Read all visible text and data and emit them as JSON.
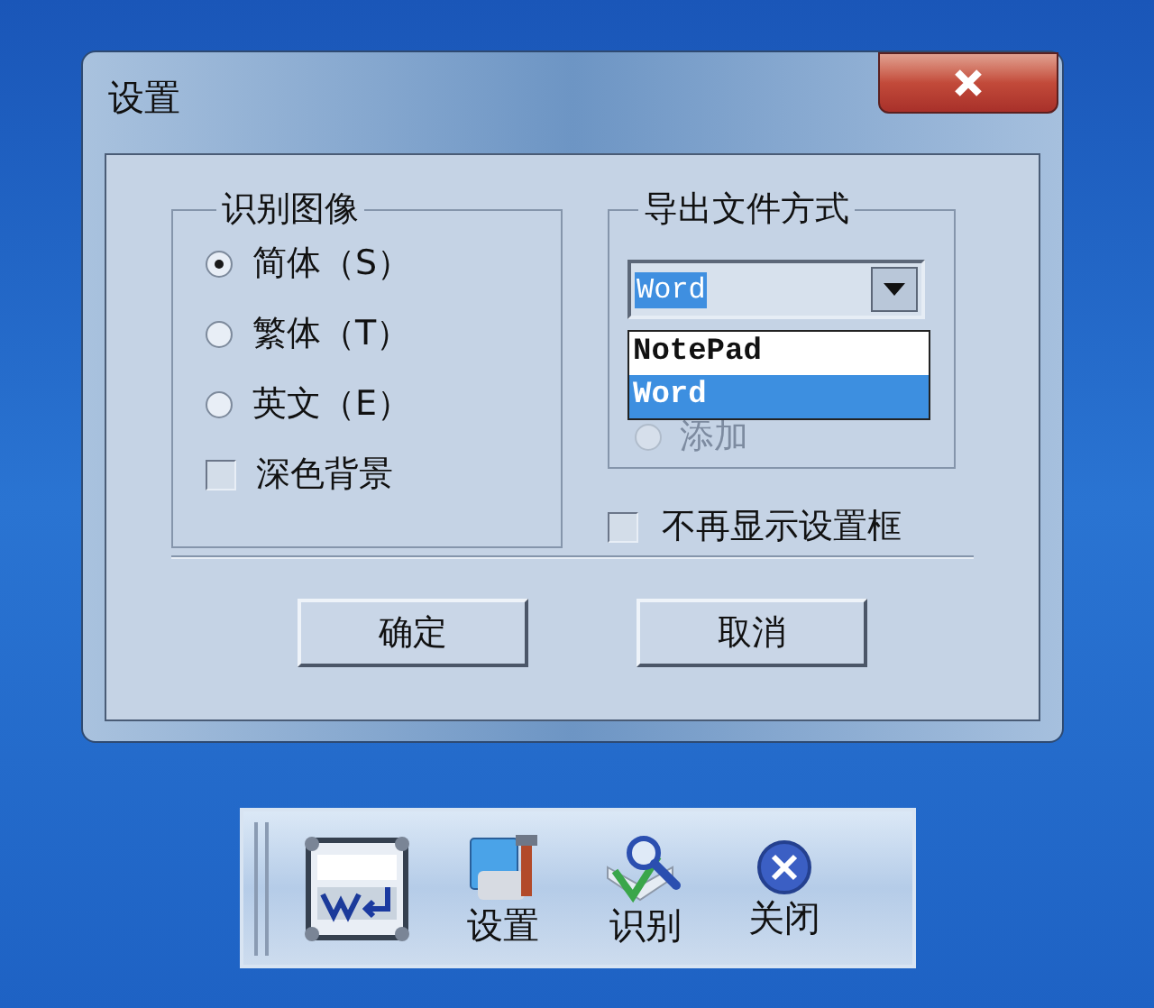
{
  "window": {
    "title": "设置"
  },
  "recognize_group": {
    "title": "识别图像",
    "options": [
      {
        "label": "简体（S）",
        "selected": true
      },
      {
        "label": "繁体（T）",
        "selected": false
      },
      {
        "label": "英文（E）",
        "selected": false
      }
    ],
    "dark_background": {
      "label": "深色背景",
      "checked": false
    }
  },
  "export_group": {
    "title": "导出文件方式",
    "combo": {
      "value": "Word",
      "expanded": true
    },
    "list": [
      {
        "label": "NotePad",
        "selected": false
      },
      {
        "label": "Word",
        "selected": true
      }
    ],
    "covered_option": {
      "label": "添加",
      "disabled": true
    }
  },
  "hide_dialog": {
    "label": "不再显示设置框",
    "checked": false
  },
  "buttons": [
    "确定",
    "取消"
  ],
  "toolbar": {
    "items": [
      {
        "kind": "logo"
      },
      {
        "kind": "settings",
        "label": "设置"
      },
      {
        "kind": "recognize",
        "label": "识别"
      },
      {
        "kind": "close",
        "label": "关闭"
      }
    ]
  }
}
